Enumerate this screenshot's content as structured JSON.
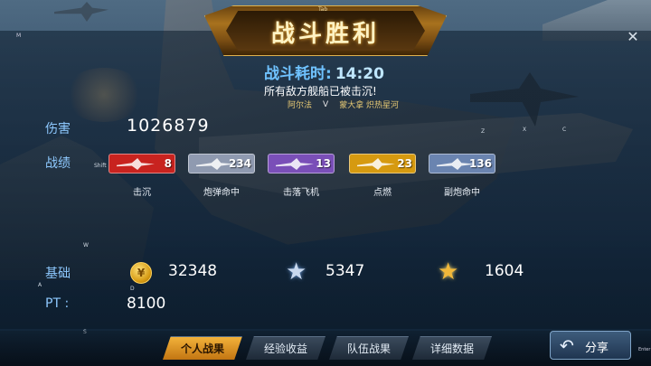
{
  "banner": {
    "title": "战斗胜利",
    "key_hint": "Tab"
  },
  "battle_time": {
    "label": "战斗耗时:",
    "value": "14:20"
  },
  "result_message": "所有敌方舰船已被击沉!",
  "matchup": {
    "player": "阿尔法",
    "vs": "V",
    "enemy": "蒙大拿 炽热星河"
  },
  "damage": {
    "label": "伤害",
    "value": "1026879"
  },
  "achievements": {
    "label": "战绩",
    "items": [
      {
        "caption": "击沉",
        "count": "8",
        "color": "#c8231f",
        "icon": "sink-icon"
      },
      {
        "caption": "炮弹命中",
        "count": "234",
        "color": "#8f9ab0",
        "icon": "shell-icon"
      },
      {
        "caption": "击落飞机",
        "count": "13",
        "color": "#7a4fb8",
        "icon": "plane-icon"
      },
      {
        "caption": "点燃",
        "count": "23",
        "color": "#d69a10",
        "icon": "fire-icon"
      },
      {
        "caption": "副炮命中",
        "count": "136",
        "color": "#6a84b0",
        "icon": "secondary-gun-icon"
      }
    ]
  },
  "base": {
    "label": "基础",
    "coins": "32348",
    "silver_stars": "5347",
    "gold_stars": "1604"
  },
  "pt": {
    "label": "PT :",
    "value": "8100"
  },
  "tabs": [
    {
      "label": "个人战果",
      "active": true
    },
    {
      "label": "经验收益",
      "active": false
    },
    {
      "label": "队伍战果",
      "active": false
    },
    {
      "label": "详细数据",
      "active": false
    }
  ],
  "share": {
    "label": "分享",
    "key_hint": "Enter"
  },
  "close": "✕",
  "key_hints": {
    "shift": "Shift",
    "m": "M",
    "w": "W",
    "a": "A",
    "d": "D",
    "s": "S",
    "z": "Z",
    "x": "X",
    "c": "C"
  },
  "colors": {
    "accent_blue": "#8ec9ff",
    "gold": "#f3b23a"
  }
}
